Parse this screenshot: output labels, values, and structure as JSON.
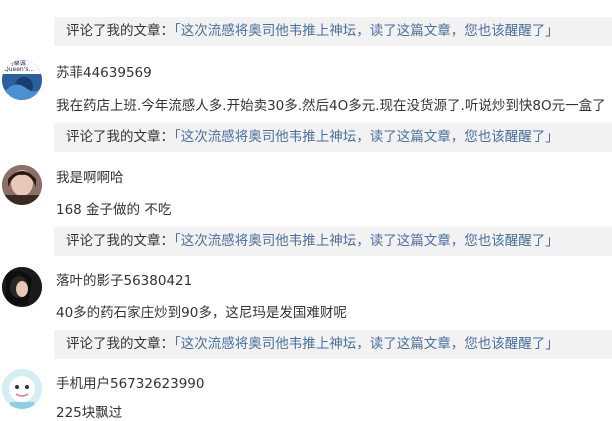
{
  "article_title": "「这次流感将奥司他韦推上神坛，读了这篇文章，您也该醒醒了」",
  "ref_label": "评论了我的文章：",
  "comments": [
    {
      "username": "苏菲44639569",
      "text": "我在药店上班.今年流感人多.开始卖30多.然后4O多元.现在没货源了.听说炒到快8O元一盒了",
      "avatar_text": "e河桑诚 Queen's..."
    },
    {
      "username": "我是啊啊哈",
      "text": "168 金子做的 不吃"
    },
    {
      "username": "落叶的影子56380421",
      "text": "40多的药石家庄炒到90多，这尼玛是发国难财呢"
    },
    {
      "username": "手机用户56732623990",
      "text": "225块飘过"
    }
  ]
}
